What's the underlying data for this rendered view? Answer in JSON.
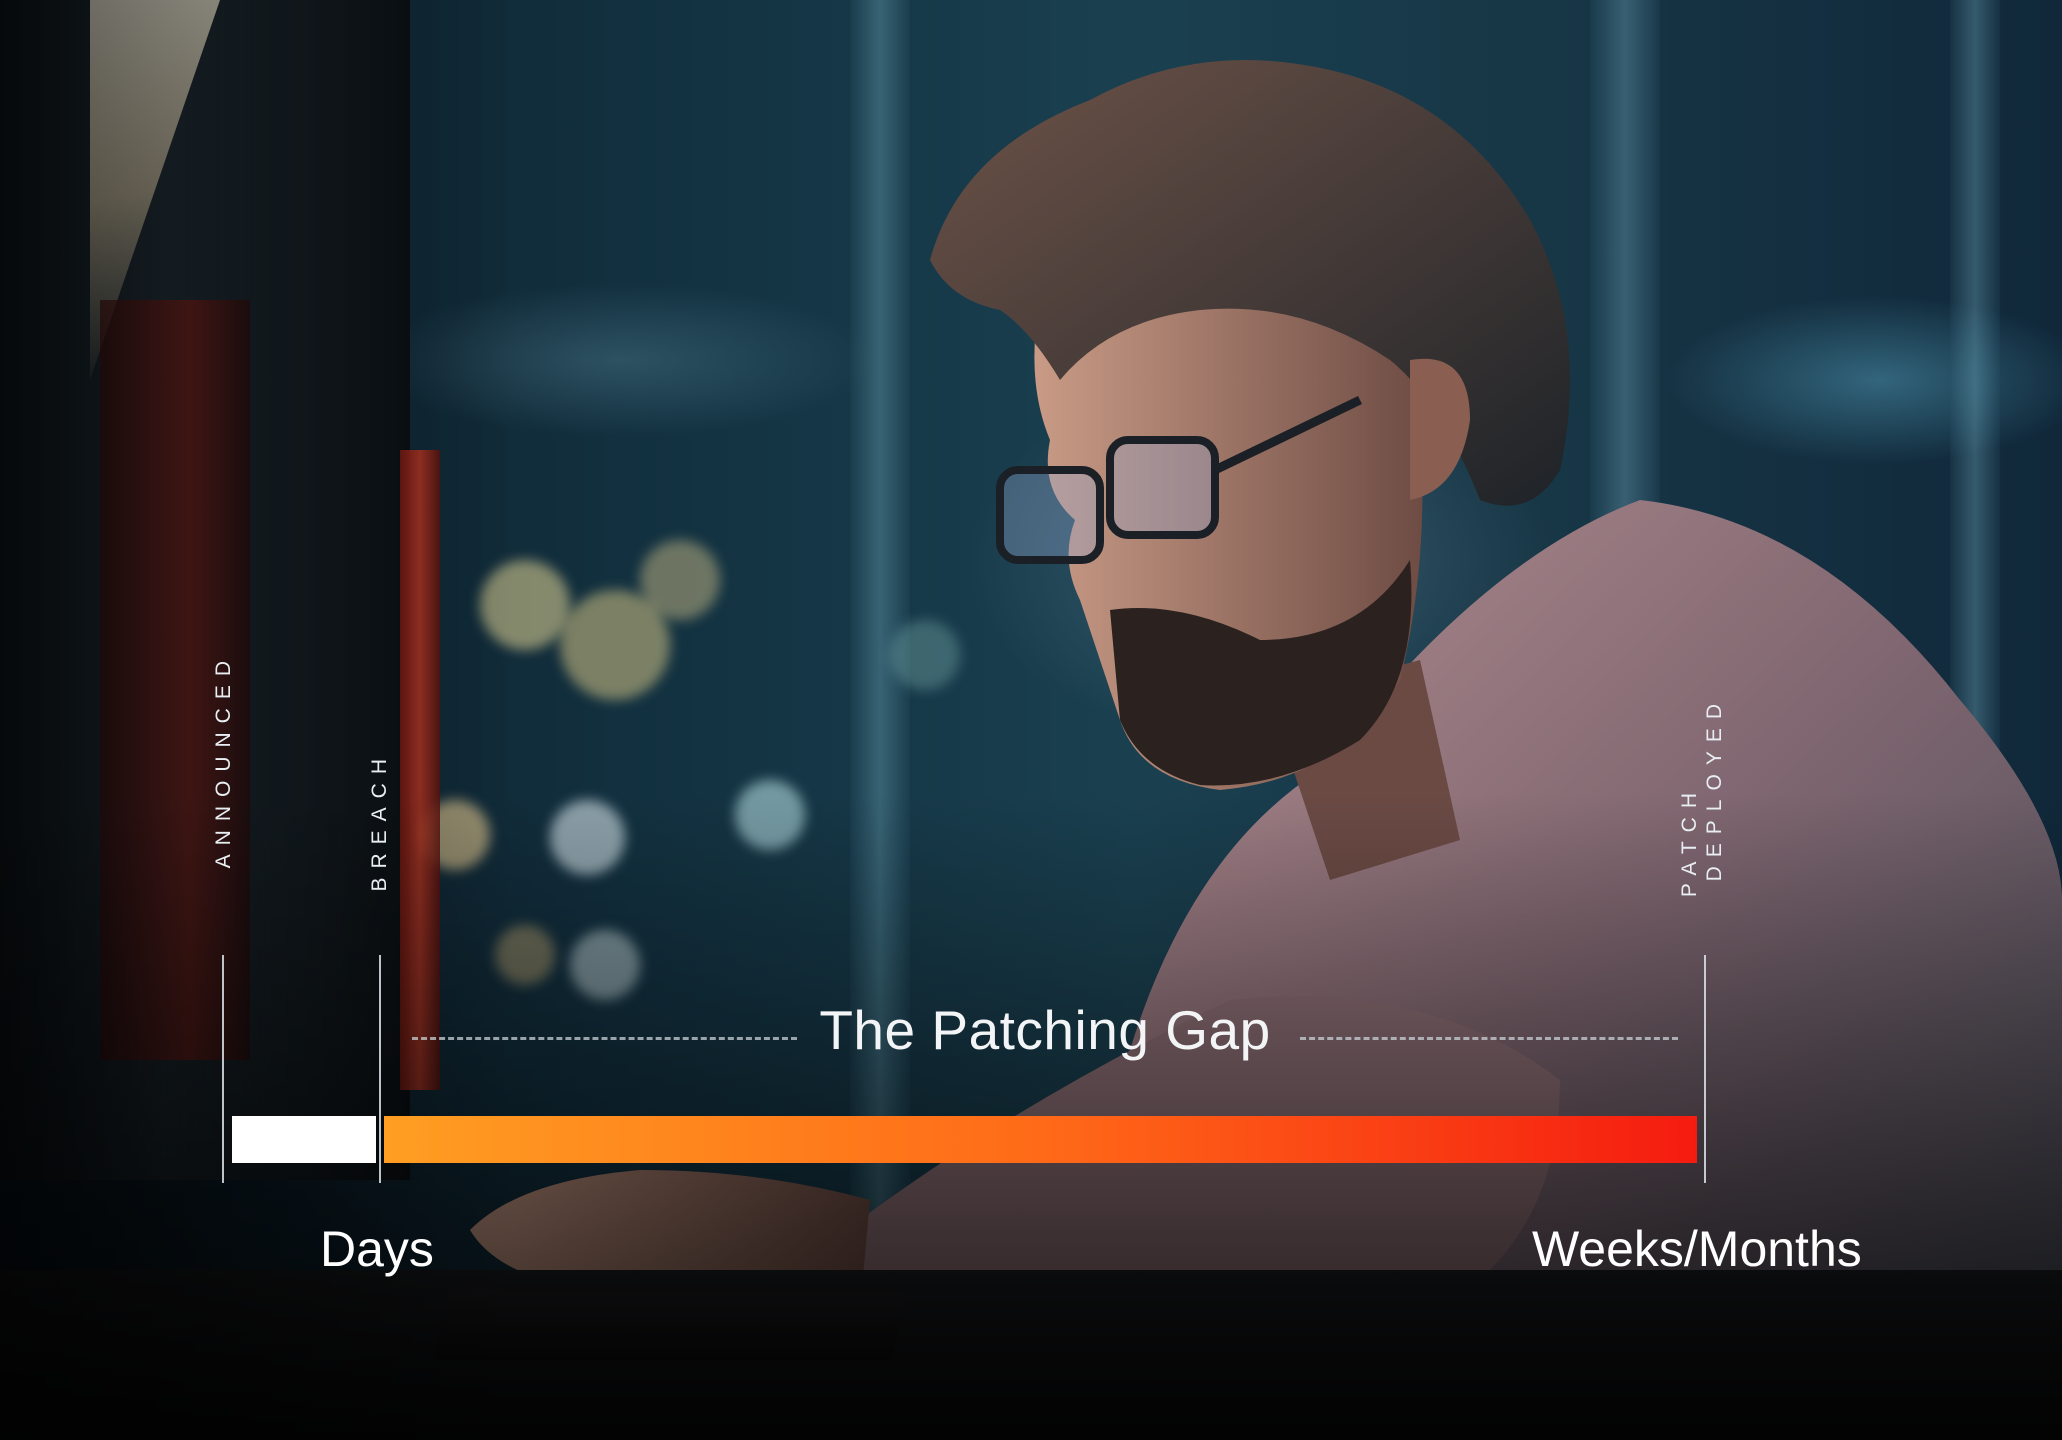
{
  "diagram": {
    "title": "The Patching Gap",
    "milestones": {
      "announced": "ANNOUNCED",
      "breach": "BREACH",
      "patch_line1": "PATCH",
      "patch_line2": "DEPLOYED"
    },
    "scale_labels": {
      "start": "Days",
      "end": "Weeks/Months"
    },
    "colors": {
      "initial_segment": "#ffffff",
      "gap_start": "#ff9e22",
      "gap_end": "#f51b10"
    }
  }
}
